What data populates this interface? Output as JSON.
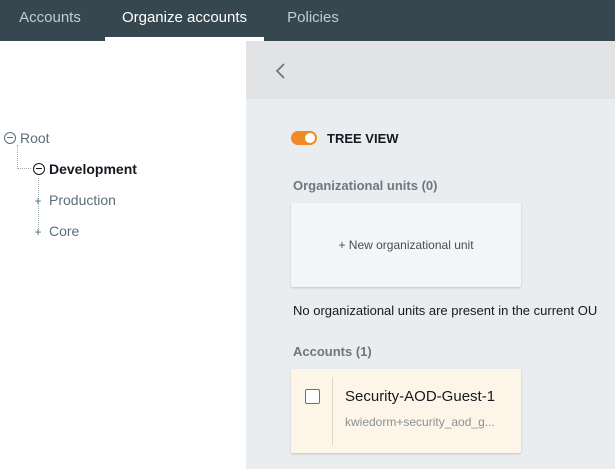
{
  "nav": {
    "tabs": [
      {
        "label": "Accounts",
        "active": false
      },
      {
        "label": "Organize accounts",
        "active": true
      },
      {
        "label": "Policies",
        "active": false
      }
    ]
  },
  "tree": {
    "root": {
      "label": "Root",
      "icon": "collapse-circle-icon"
    },
    "nodes": [
      {
        "label": "Development",
        "selected": true,
        "icon": "collapse-circle-icon"
      },
      {
        "label": "Production",
        "selected": false,
        "icon": "plus-icon"
      },
      {
        "label": "Core",
        "selected": false,
        "icon": "plus-icon"
      }
    ]
  },
  "panel": {
    "back_icon": "chevron-left-icon",
    "tree_view": {
      "label": "TREE VIEW",
      "enabled": true
    },
    "ou_section": {
      "title": "Organizational units (0)",
      "new_ou_label": "+ New organizational unit",
      "empty_message": "No organizational units are present in the current OU"
    },
    "accounts_section": {
      "title": "Accounts (1)",
      "accounts": [
        {
          "name": "Security-AOD-Guest-1",
          "email": "kwiedorm+security_aod_g...",
          "checked": false
        }
      ]
    }
  },
  "colors": {
    "nav_bg": "#37474f",
    "toggle_on": "#f08a24",
    "account_card_bg": "#fdf5e8",
    "panel_bg": "#eaedef"
  }
}
